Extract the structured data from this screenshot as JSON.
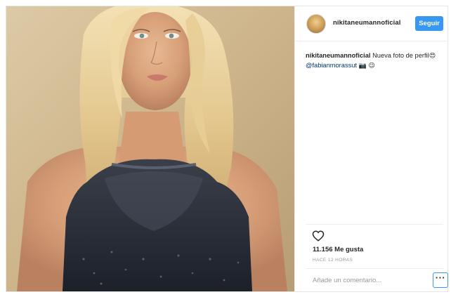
{
  "post": {
    "username": "nikitaneumannoficial",
    "follow_label": "Seguir",
    "caption": {
      "user": "nikitaneumannoficial",
      "text": " Nueva foto de perfil",
      "emoji_1": "😍",
      "mention": "@fabianmorassut",
      "emoji_2": "📷",
      "emoji_3": "😉"
    },
    "likes": "11.156 Me gusta",
    "time": "HACE 12 HORAS",
    "comment_placeholder": "Añade un comentario...",
    "more_label": "···"
  },
  "icons": {
    "heart": "heart-icon",
    "more": "more-options-icon"
  },
  "colors": {
    "accent": "#3897f0",
    "mention": "#003569",
    "muted": "#999999"
  }
}
